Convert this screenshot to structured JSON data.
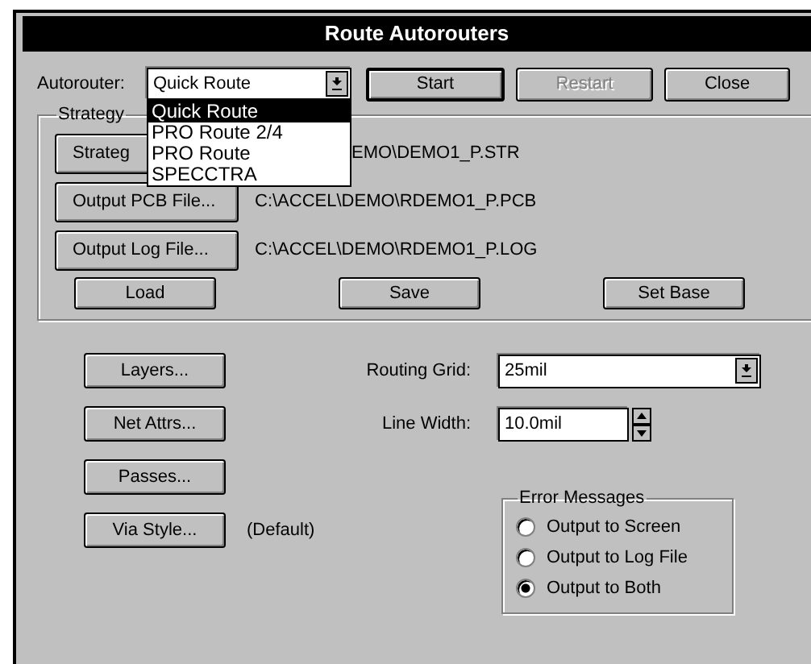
{
  "window": {
    "title": "Route Autorouters"
  },
  "autorouter": {
    "label": "Autorouter:",
    "value": "Quick Route",
    "expanded": true,
    "options": [
      {
        "label": "Quick Route",
        "selected": true
      },
      {
        "label": "PRO Route 2/4",
        "selected": false
      },
      {
        "label": "PRO Route",
        "selected": false
      },
      {
        "label": "SPECCTRA",
        "selected": false
      }
    ]
  },
  "buttons": [
    {
      "label": "Start",
      "disabled": false,
      "default": true
    },
    {
      "label": "Restart",
      "disabled": true,
      "default": false
    },
    {
      "label": "Close",
      "disabled": false,
      "default": false
    }
  ],
  "strategy": {
    "title": "Strategy",
    "files": [
      {
        "button": "Strateg",
        "path": "EMO\\DEMO1_P.STR"
      },
      {
        "button": "Output PCB File...",
        "path": "C:\\ACCEL\\DEMO\\RDEMO1_P.PCB"
      },
      {
        "button": "Output Log File...",
        "path": "C:\\ACCEL\\DEMO\\RDEMO1_P.LOG"
      }
    ],
    "actions": [
      "Load",
      "Save",
      "Set Base"
    ]
  },
  "option_buttons": [
    {
      "label": "Layers..."
    },
    {
      "label": "Net Attrs..."
    },
    {
      "label": "Passes..."
    },
    {
      "label": "Via Style...",
      "note": "(Default)"
    }
  ],
  "routing_grid": {
    "label": "Routing Grid:",
    "value": "25mil"
  },
  "line_width": {
    "label": "Line Width:",
    "value": "10.0mil"
  },
  "error_messages": {
    "title": "Error Messages",
    "choices": [
      {
        "label": "Output to Screen",
        "selected": false
      },
      {
        "label": "Output to Log File",
        "selected": false
      },
      {
        "label": "Output to Both",
        "selected": true
      }
    ]
  }
}
